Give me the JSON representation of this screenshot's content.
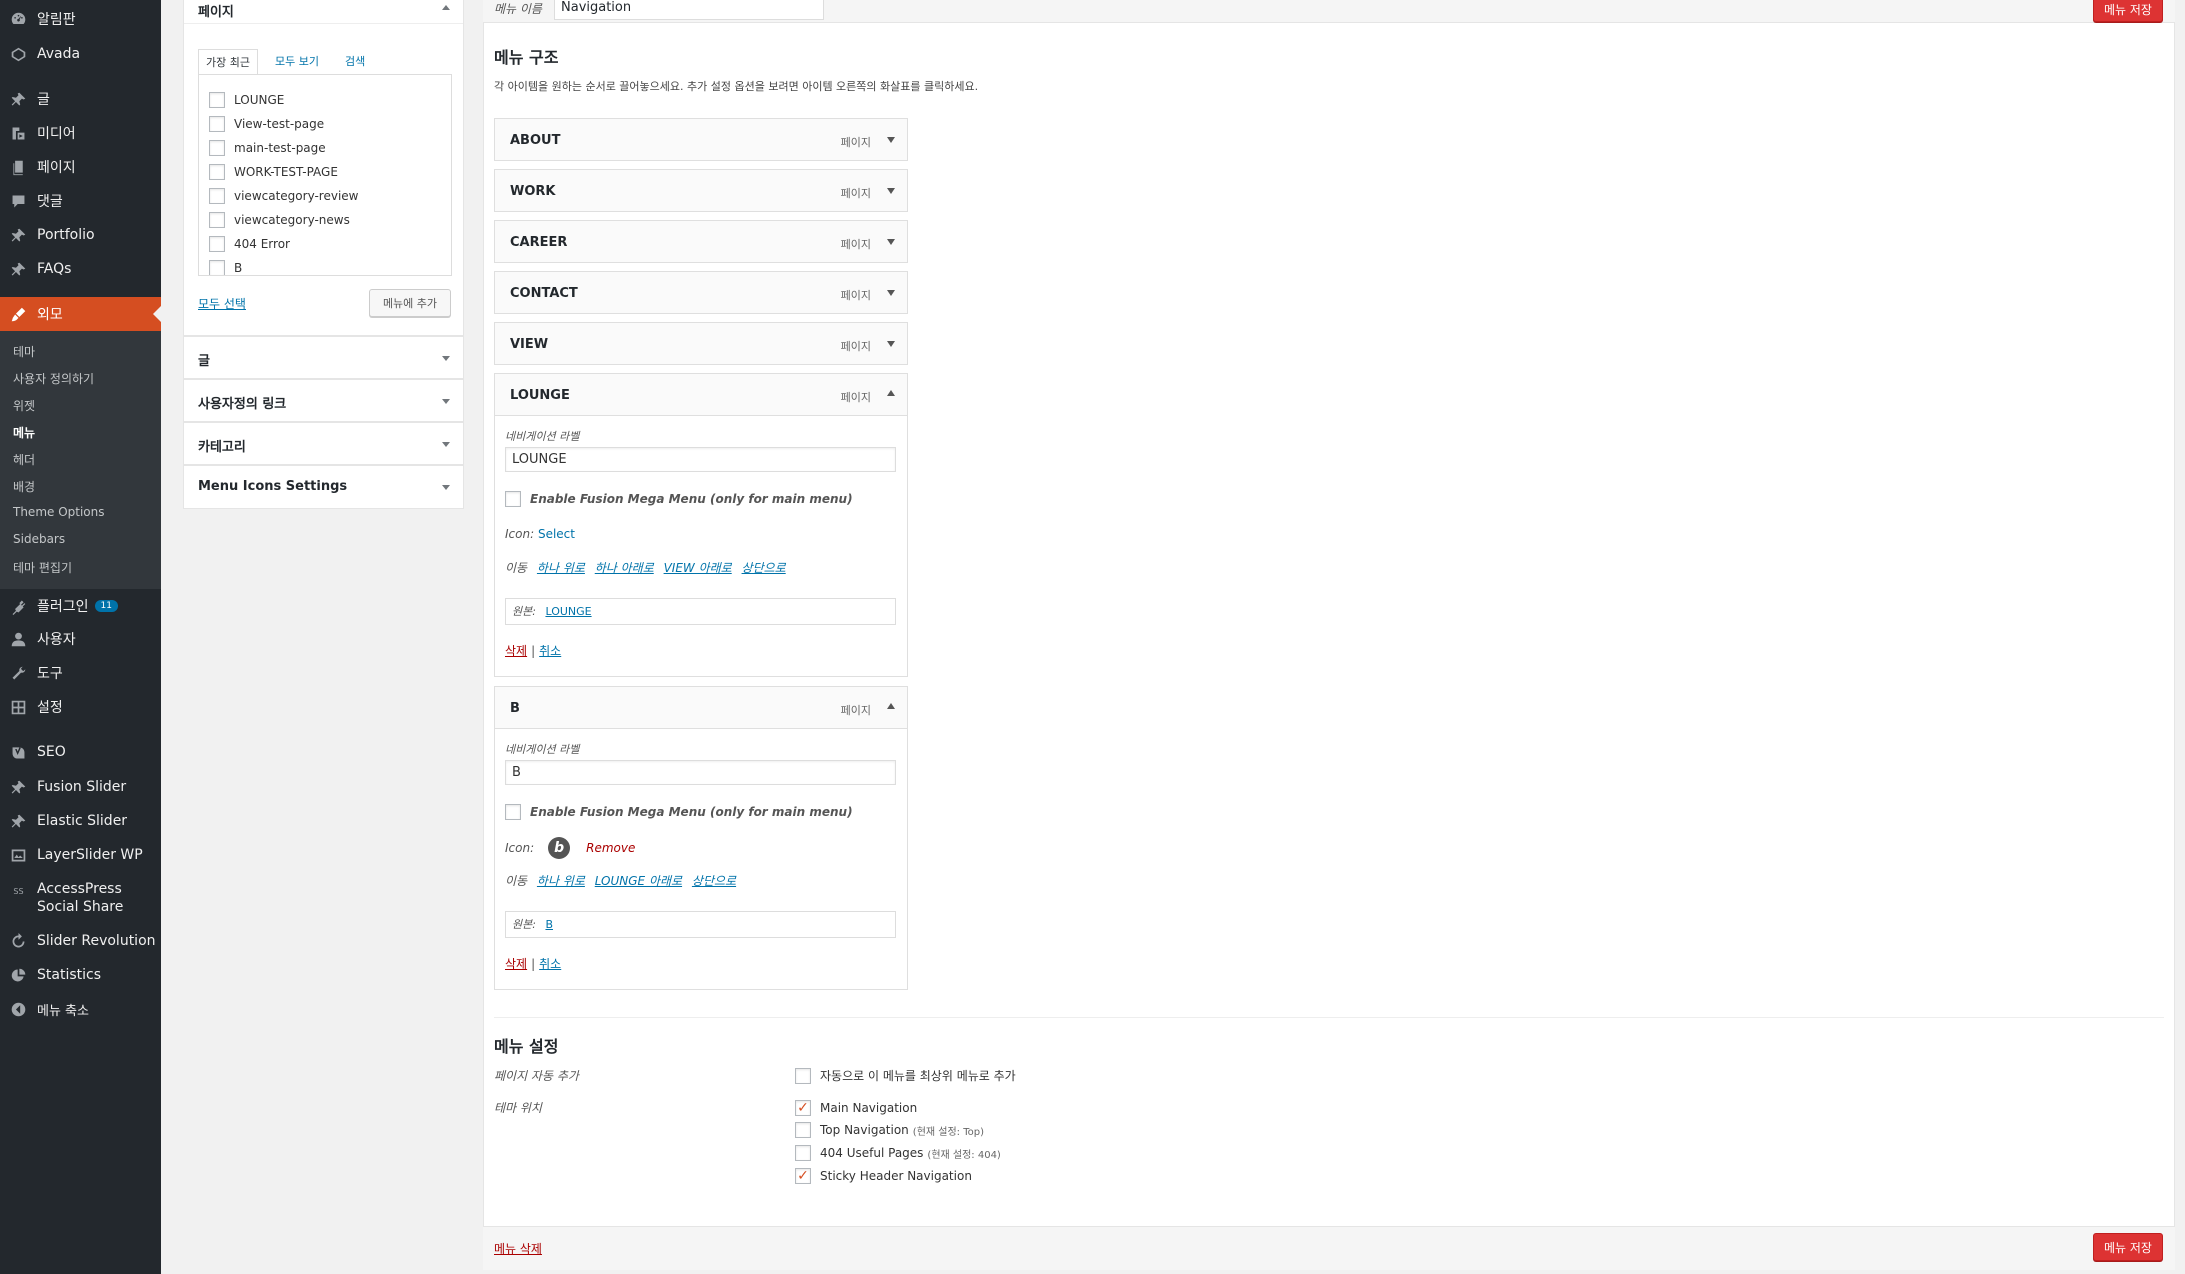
{
  "sidebar": {
    "items": [
      {
        "label": "알림판",
        "icon": "dashboard-icon"
      },
      {
        "label": "Avada",
        "icon": "avada-icon"
      },
      {
        "label": "글",
        "icon": "pin-icon"
      },
      {
        "label": "미디어",
        "icon": "media-icon"
      },
      {
        "label": "페이지",
        "icon": "page-icon"
      },
      {
        "label": "댓글",
        "icon": "comment-icon"
      },
      {
        "label": "Portfolio",
        "icon": "pin-icon"
      },
      {
        "label": "FAQs",
        "icon": "pin-icon"
      },
      {
        "label": "외모",
        "icon": "appearance-icon"
      },
      {
        "label": "플러그인",
        "icon": "plugin-icon",
        "badge": "11"
      },
      {
        "label": "사용자",
        "icon": "user-icon"
      },
      {
        "label": "도구",
        "icon": "tools-icon"
      },
      {
        "label": "설정",
        "icon": "settings-icon"
      },
      {
        "label": "SEO",
        "icon": "seo-icon"
      },
      {
        "label": "Fusion Slider",
        "icon": "pin-icon"
      },
      {
        "label": "Elastic Slider",
        "icon": "pin-icon"
      },
      {
        "label": "LayerSlider WP",
        "icon": "layers-icon"
      },
      {
        "label": "AccessPress Social Share",
        "icon": "share-icon",
        "line1": "AccessPress",
        "line2": "Social Share"
      },
      {
        "label": "Slider Revolution",
        "icon": "refresh-icon"
      },
      {
        "label": "Statistics",
        "icon": "pie-chart-icon"
      },
      {
        "label": "메뉴 축소",
        "icon": "collapse-icon"
      }
    ],
    "submenu": [
      "테마",
      "사용자 정의하기",
      "위젯",
      "메뉴",
      "헤더",
      "배경",
      "Theme Options",
      "Sidebars",
      "테마 편집기"
    ]
  },
  "pages_box": {
    "title": "페이지",
    "tabs": [
      "가장 최근",
      "모두 보기",
      "검색"
    ],
    "items": [
      "LOUNGE",
      "View-test-page",
      "main-test-page",
      "WORK-TEST-PAGE",
      "viewcategory-review",
      "viewcategory-news",
      "404 Error",
      "B"
    ],
    "select_all": "모두 선택",
    "add_button": "메뉴에 추가"
  },
  "accordions": [
    "글",
    "사용자정의 링크",
    "카테고리",
    "Menu Icons Settings"
  ],
  "menu_name": {
    "label": "메뉴 이름",
    "value": "Navigation"
  },
  "save_button": "메뉴 저장",
  "structure": {
    "title": "메뉴 구조",
    "description": "각 아이템을 원하는 순서로 끌어놓으세요. 추가 설정 옵션을 보려면 아이템 오른쪽의 화살표를 클릭하세요.",
    "type_label": "페이지",
    "collapsed_items": [
      "ABOUT",
      "WORK",
      "CAREER",
      "CONTACT",
      "VIEW"
    ],
    "lounge": {
      "title": "LOUNGE",
      "nav_label": "네비게이션 라벨",
      "nav_value": "LOUNGE",
      "mega": "Enable Fusion Mega Menu (only for main menu)",
      "icon_label": "Icon:",
      "icon_select": "Select",
      "move_label": "이동",
      "move_links": [
        "하나 위로",
        "하나 아래로",
        "VIEW 아래로",
        "상단으로"
      ],
      "original_label": "원본:",
      "original_link": "LOUNGE",
      "delete": "삭제",
      "cancel": "취소"
    },
    "b": {
      "title": "B",
      "nav_label": "네비게이션 라벨",
      "nav_value": "B",
      "mega": "Enable Fusion Mega Menu (only for main menu)",
      "icon_label": "Icon:",
      "icon_glyph": "b",
      "icon_remove": "Remove",
      "move_label": "이동",
      "move_links": [
        "하나 위로",
        "LOUNGE 아래로",
        "상단으로"
      ],
      "original_label": "원본:",
      "original_link": "B",
      "delete": "삭제",
      "cancel": "취소"
    }
  },
  "menu_settings": {
    "title": "메뉴 설정",
    "auto_add_label": "페이지 자동 추가",
    "auto_add_option": "자동으로 이 메뉴를 최상위 메뉴로 추가",
    "locations_label": "테마 위치",
    "locations": [
      {
        "name": "Main Navigation",
        "note": "",
        "checked": true
      },
      {
        "name": "Top Navigation",
        "note": "(현재 설정: Top)",
        "checked": false
      },
      {
        "name": "404 Useful Pages",
        "note": "(현재 설정: 404)",
        "checked": false
      },
      {
        "name": "Sticky Header Navigation",
        "note": "",
        "checked": true
      }
    ]
  },
  "delete_menu": "메뉴 삭제",
  "colors": {
    "accent": "#dd3333",
    "sidebar": "#23282d",
    "current": "#d54e21",
    "link": "#0073aa"
  }
}
